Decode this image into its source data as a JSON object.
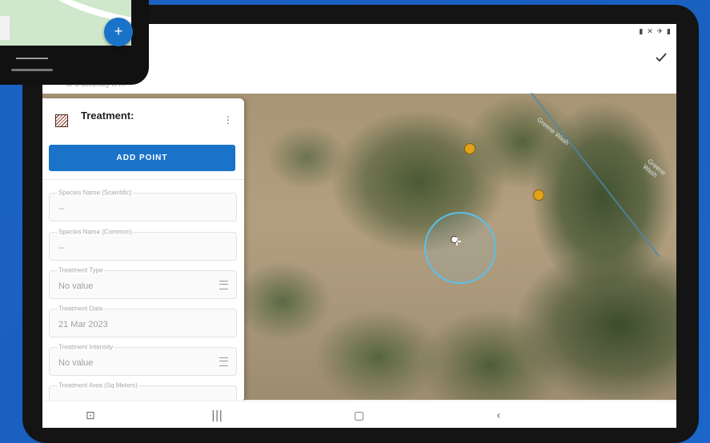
{
  "app": {
    "status_icons": "▮ ✕ ✈ ▮",
    "accuracy_text": "or a accuracy is m"
  },
  "panel": {
    "title": "Treatment:",
    "add_point_label": "ADD POINT",
    "fields": [
      {
        "label": "Species Name (Scientific)",
        "value": "--",
        "has_menu": false
      },
      {
        "label": "Species Name (Common)",
        "value": "--",
        "has_menu": false
      },
      {
        "label": "Treatment Type",
        "value": "No value",
        "has_menu": true
      },
      {
        "label": "Treatment Date",
        "value": "21 Mar 2023",
        "has_menu": false
      },
      {
        "label": "Treatment Intensity",
        "value": "No value",
        "has_menu": true
      },
      {
        "label": "Treatment Area (Sq Meters)",
        "value": "",
        "has_menu": false
      }
    ]
  },
  "map": {
    "labels": [
      "Greene Wash",
      "Greene Wash"
    ],
    "accuracy_color": "#5cc0ea",
    "marker_color": "#e0a21c"
  },
  "navbar": {
    "screenshot_icon": "screenshot-icon",
    "recents_icon": "recents-icon",
    "home_icon": "home-icon",
    "back_icon": "back-icon"
  },
  "phone": {
    "fab_label": "+"
  }
}
